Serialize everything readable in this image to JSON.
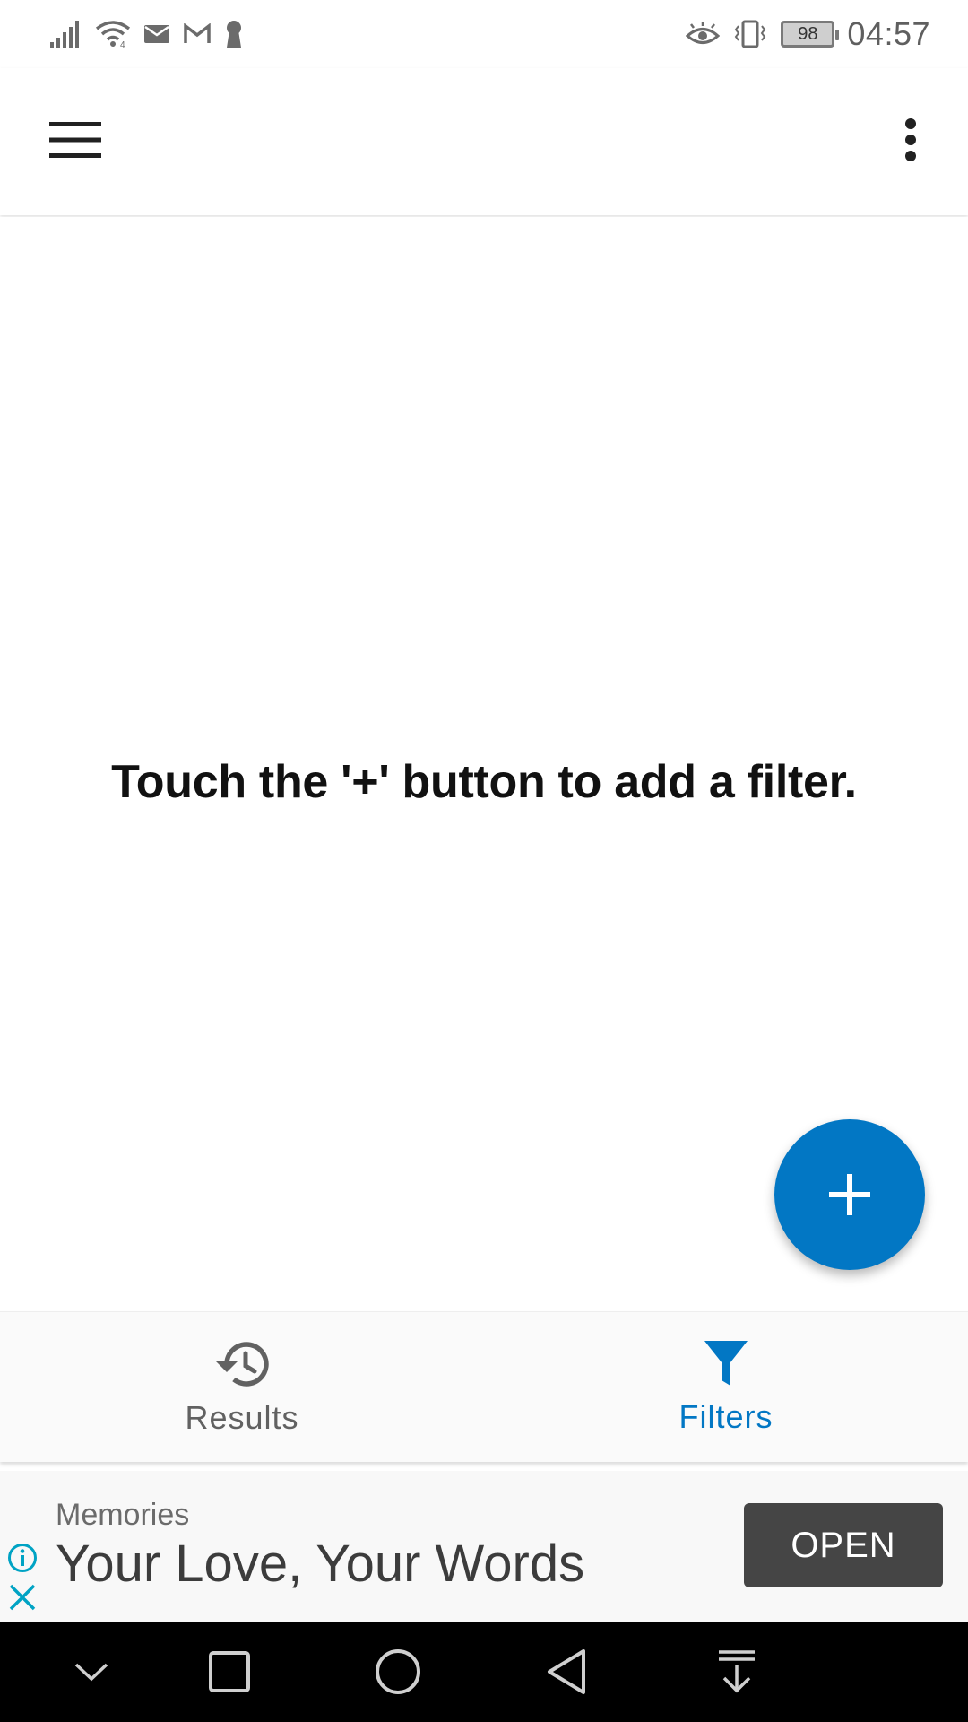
{
  "status_bar": {
    "time": "04:57",
    "battery_level": "98",
    "icons": [
      "signal-icon",
      "wifi-icon",
      "mail-icon",
      "gmail-icon",
      "keyhole-icon",
      "eye-comfort-icon",
      "vibrate-icon",
      "battery-icon"
    ]
  },
  "app_bar": {
    "icons": [
      "hamburger-menu-icon",
      "more-vert-icon"
    ]
  },
  "main": {
    "empty_message": "Touch the '+' button to add a filter."
  },
  "fab": {
    "icon": "plus-icon",
    "color": "#0277c4"
  },
  "bottom_nav": {
    "items": [
      {
        "label": "Results",
        "icon": "history-icon",
        "active": false
      },
      {
        "label": "Filters",
        "icon": "filter-icon",
        "active": true
      }
    ],
    "active_color": "#0277c4",
    "inactive_color": "#616161"
  },
  "ad": {
    "source": "Memories",
    "headline": "Your Love, Your Words",
    "button_label": "OPEN",
    "icons": [
      "ad-info-icon",
      "ad-close-icon"
    ]
  },
  "system_nav": {
    "icons": [
      "collapse-down-icon",
      "recents-square-icon",
      "home-circle-icon",
      "back-triangle-icon",
      "notification-pull-icon"
    ]
  }
}
